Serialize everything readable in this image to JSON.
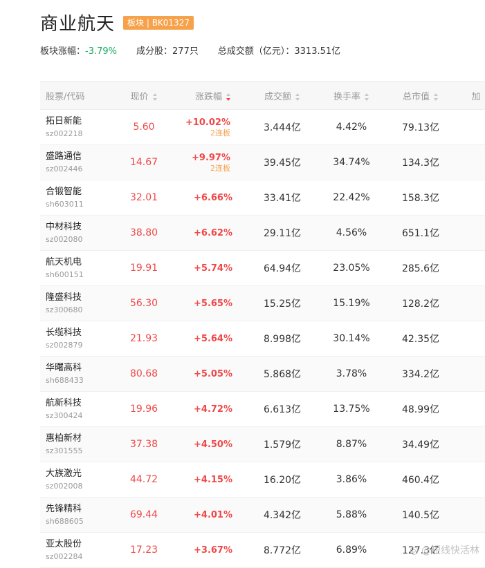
{
  "header": {
    "title": "商业航天",
    "badge": "板块 | BK01327"
  },
  "summary": {
    "change_label": "板块涨幅：",
    "change_value": "-3.79%",
    "count_label": "成分股：",
    "count_value": "277只",
    "turnover_label": "总成交额（亿元）：",
    "turnover_value": "3313.51亿"
  },
  "columns": {
    "name": "股票/代码",
    "price": "现价",
    "change": "涨跌幅",
    "volume": "成交额",
    "turnover": "换手率",
    "cap": "总市值",
    "more": "加"
  },
  "rows": [
    {
      "name": "拓日新能",
      "code": "sz002218",
      "price": "5.60",
      "change": "+10.02%",
      "streak": "2连板",
      "volume": "3.444亿",
      "turnover": "4.42%",
      "cap": "79.13亿"
    },
    {
      "name": "盛路通信",
      "code": "sz002446",
      "price": "14.67",
      "change": "+9.97%",
      "streak": "2连板",
      "volume": "39.45亿",
      "turnover": "34.74%",
      "cap": "134.3亿"
    },
    {
      "name": "合锻智能",
      "code": "sh603011",
      "price": "32.01",
      "change": "+6.66%",
      "streak": "",
      "volume": "33.41亿",
      "turnover": "22.42%",
      "cap": "158.3亿"
    },
    {
      "name": "中材科技",
      "code": "sz002080",
      "price": "38.80",
      "change": "+6.62%",
      "streak": "",
      "volume": "29.11亿",
      "turnover": "4.56%",
      "cap": "651.1亿"
    },
    {
      "name": "航天机电",
      "code": "sh600151",
      "price": "19.91",
      "change": "+5.74%",
      "streak": "",
      "volume": "64.94亿",
      "turnover": "23.05%",
      "cap": "285.6亿"
    },
    {
      "name": "隆盛科技",
      "code": "sz300680",
      "price": "56.30",
      "change": "+5.65%",
      "streak": "",
      "volume": "15.25亿",
      "turnover": "15.19%",
      "cap": "128.2亿"
    },
    {
      "name": "长缆科技",
      "code": "sz002879",
      "price": "21.93",
      "change": "+5.64%",
      "streak": "",
      "volume": "8.998亿",
      "turnover": "30.14%",
      "cap": "42.35亿"
    },
    {
      "name": "华曙高科",
      "code": "sh688433",
      "price": "80.68",
      "change": "+5.05%",
      "streak": "",
      "volume": "5.868亿",
      "turnover": "3.78%",
      "cap": "334.2亿"
    },
    {
      "name": "航新科技",
      "code": "sz300424",
      "price": "19.96",
      "change": "+4.72%",
      "streak": "",
      "volume": "6.613亿",
      "turnover": "13.75%",
      "cap": "48.99亿"
    },
    {
      "name": "惠柏新材",
      "code": "sz301555",
      "price": "37.38",
      "change": "+4.50%",
      "streak": "",
      "volume": "1.579亿",
      "turnover": "8.87%",
      "cap": "34.49亿"
    },
    {
      "name": "大族激光",
      "code": "sz002008",
      "price": "44.72",
      "change": "+4.15%",
      "streak": "",
      "volume": "16.20亿",
      "turnover": "3.86%",
      "cap": "460.4亿"
    },
    {
      "name": "先锋精科",
      "code": "sh688605",
      "price": "69.44",
      "change": "+4.01%",
      "streak": "",
      "volume": "4.342亿",
      "turnover": "5.88%",
      "cap": "140.5亿"
    },
    {
      "name": "亚太股份",
      "code": "sz002284",
      "price": "17.23",
      "change": "+3.67%",
      "streak": "",
      "volume": "8.772亿",
      "turnover": "6.89%",
      "cap": "127.3亿"
    }
  ],
  "watermark": "@短线快活林",
  "colors": {
    "up": "#f04848",
    "down": "#16a860",
    "badge": "#f7a24b",
    "streak": "#f7a24b"
  }
}
